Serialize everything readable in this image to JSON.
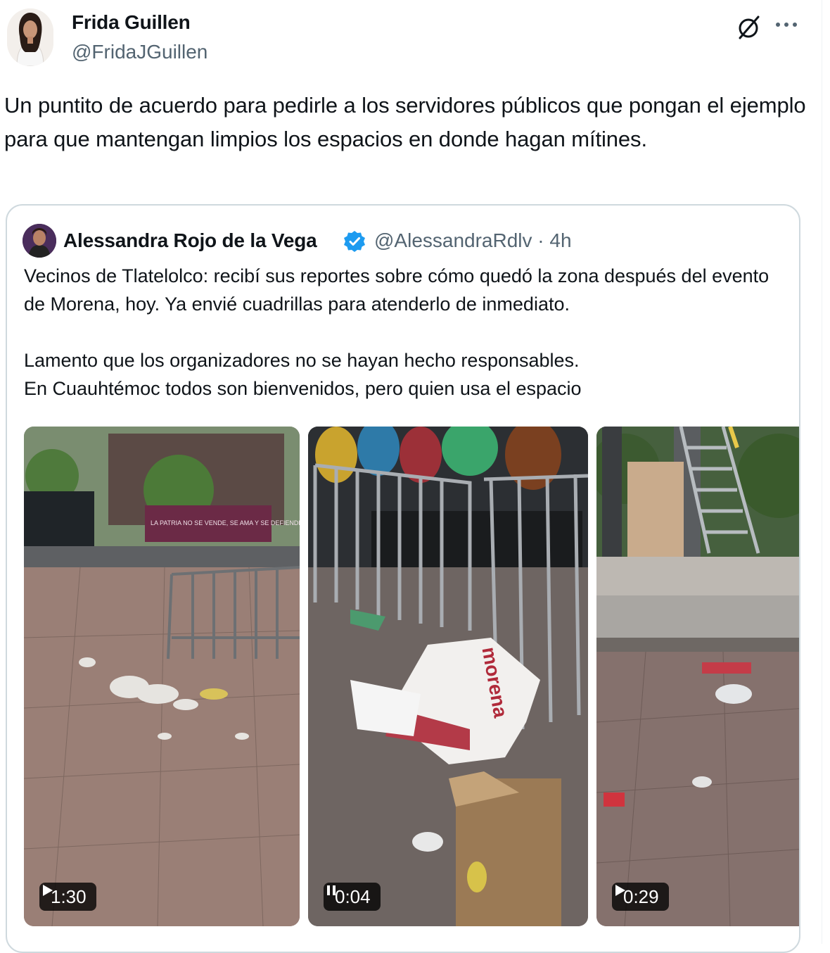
{
  "tweet": {
    "author_name": "Frida Guillen",
    "author_handle": "@FridaJGuillen",
    "text": "Un puntito de acuerdo para pedirle a los servidores públicos que pongan el ejemplo para que mantengan limpios los espacios en donde hagan mítines.",
    "icons": {
      "grok": "no-entry-slash-icon",
      "more": "ellipsis-icon"
    }
  },
  "quoted": {
    "author_name": "Alessandra Rojo de la Vega",
    "verified": true,
    "author_handle": "@AlessandraRdlv · 4h",
    "text": "Vecinos de Tlatelolco: recibí sus reportes sobre cómo quedó la zona después del evento de Morena, hoy. Ya envié cuadrillas para atenderlo de inmediato.\n\nLamento que los organizadores no se hayan hecho responsables.\nEn Cuauhtémoc todos son bienvenidos, pero quien usa el espacio",
    "media": [
      {
        "duration": "1:30",
        "state": "play",
        "banner_text": "LA PATRIA NO SE VENDE, SE AMA Y SE DEFIENDE"
      },
      {
        "duration": "0:04",
        "state": "pause",
        "banner_text": "morena"
      },
      {
        "duration": "0:29",
        "state": "play"
      }
    ]
  },
  "colors": {
    "text": "#0f1419",
    "secondary": "#536471",
    "border": "#cfd9de",
    "verified": "#1d9bf0"
  }
}
